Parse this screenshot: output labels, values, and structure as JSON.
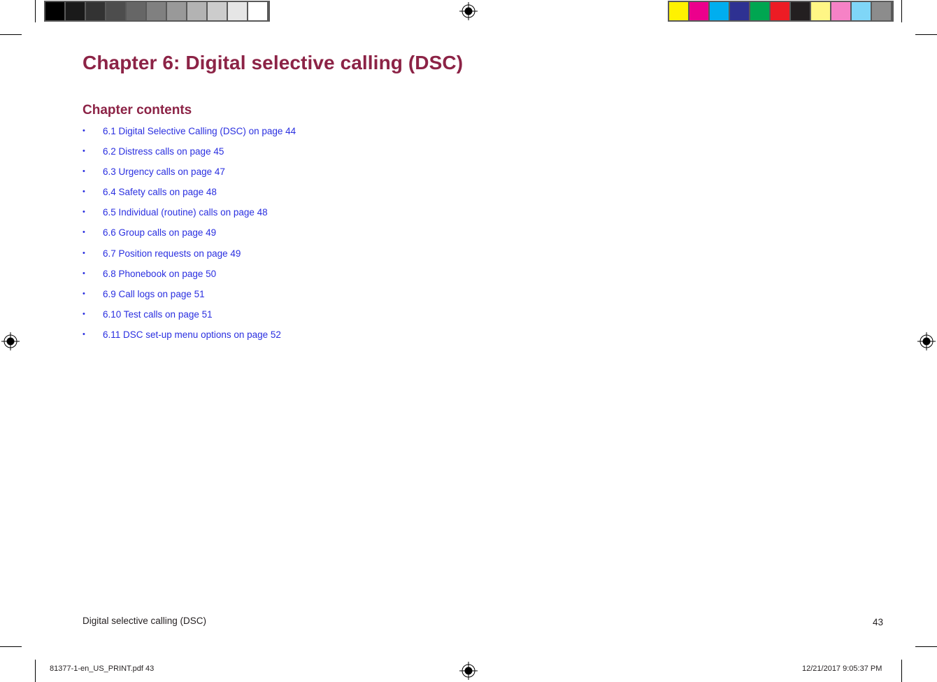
{
  "print_marks": {
    "grayscale_bar": [
      "#000000",
      "#1a1a1a",
      "#333333",
      "#4d4d4d",
      "#666666",
      "#808080",
      "#999999",
      "#b3b3b3",
      "#cccccc",
      "#e6e6e6",
      "#ffffff"
    ],
    "color_bar": [
      "#fff200",
      "#ec008c",
      "#00aeef",
      "#2e3192",
      "#00a651",
      "#ed1c24",
      "#231f20",
      "#fff685",
      "#f682c6",
      "#7fd6f7",
      "#8c8c8c"
    ],
    "slug_left": "81377-1-en_US_PRINT.pdf   43",
    "slug_right": "12/21/2017   9:05:37 PM"
  },
  "document": {
    "chapter_title": "Chapter 6: Digital selective calling (DSC)",
    "contents_heading": "Chapter contents",
    "bullet": "•",
    "toc": [
      {
        "label": "6.1 Digital Selective Calling (DSC) on page  44"
      },
      {
        "label": "6.2 Distress calls on page  45"
      },
      {
        "label": "6.3 Urgency calls on page  47"
      },
      {
        "label": "6.4 Safety calls on page  48"
      },
      {
        "label": "6.5 Individual (routine) calls on page  48"
      },
      {
        "label": "6.6 Group calls on page  49"
      },
      {
        "label": "6.7 Position requests on page  49"
      },
      {
        "label": "6.8 Phonebook on page  50"
      },
      {
        "label": "6.9 Call logs on page  51"
      },
      {
        "label": "6.10  Test  calls on page  51"
      },
      {
        "label": "6.11  DSC set-up menu options on page  52"
      }
    ],
    "footer_section": "Digital selective calling (DSC)",
    "page_number": "43",
    "colors": {
      "heading": "#8c2346",
      "link": "#2a2fe0",
      "body": "#231f20"
    }
  }
}
